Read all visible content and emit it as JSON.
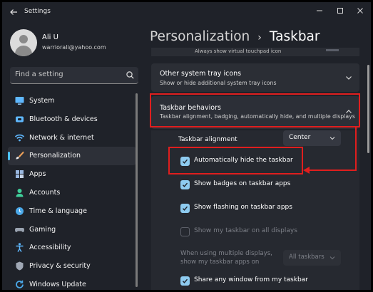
{
  "window": {
    "title": "Settings",
    "controls": {
      "minimize": "—",
      "maximize": "☐",
      "close": "✕"
    }
  },
  "user": {
    "name": "Ali U",
    "email": "warriorali@yahoo.com"
  },
  "search": {
    "placeholder": "Find a setting"
  },
  "sidebar": {
    "items": [
      {
        "label": "System",
        "icon": "monitor-icon"
      },
      {
        "label": "Bluetooth & devices",
        "icon": "bluetooth-icon"
      },
      {
        "label": "Network & internet",
        "icon": "wifi-icon"
      },
      {
        "label": "Personalization",
        "icon": "brush-icon",
        "selected": true
      },
      {
        "label": "Apps",
        "icon": "apps-icon"
      },
      {
        "label": "Accounts",
        "icon": "person-icon"
      },
      {
        "label": "Time & language",
        "icon": "globe-clock-icon"
      },
      {
        "label": "Gaming",
        "icon": "controller-icon"
      },
      {
        "label": "Accessibility",
        "icon": "accessibility-icon"
      },
      {
        "label": "Privacy & security",
        "icon": "shield-icon"
      },
      {
        "label": "Windows Update",
        "icon": "update-icon"
      }
    ]
  },
  "header": {
    "parent": "Personalization",
    "separator": "›",
    "current": "Taskbar"
  },
  "content": {
    "cut_text": "Always show virtual touchpad icon",
    "other_tray": {
      "title": "Other system tray icons",
      "subtitle": "Show or hide additional system tray icons"
    },
    "behaviors": {
      "title": "Taskbar behaviors",
      "subtitle": "Taskbar alignment, badging, automatically hide, and multiple displays",
      "alignment_label": "Taskbar alignment",
      "alignment_value": "Center",
      "options": [
        {
          "label": "Automatically hide the taskbar",
          "checked": true,
          "enabled": true
        },
        {
          "label": "Show badges on taskbar apps",
          "checked": true,
          "enabled": true
        },
        {
          "label": "Show flashing on taskbar apps",
          "checked": true,
          "enabled": true
        },
        {
          "label": "Show my taskbar on all displays",
          "checked": false,
          "enabled": false
        }
      ],
      "multi_display_line1": "When using multiple displays,",
      "multi_display_line2": "show my taskbar apps on",
      "multi_display_value": "All taskbars",
      "share_window": {
        "label": "Share any window from my taskbar",
        "checked": true
      }
    }
  },
  "colors": {
    "accent": "#4cc2ff",
    "checkbox": "#8ecbf0",
    "annotation": "#e01e1e",
    "window_bg": "#1f2229",
    "card_bg": "#2b2e35"
  }
}
